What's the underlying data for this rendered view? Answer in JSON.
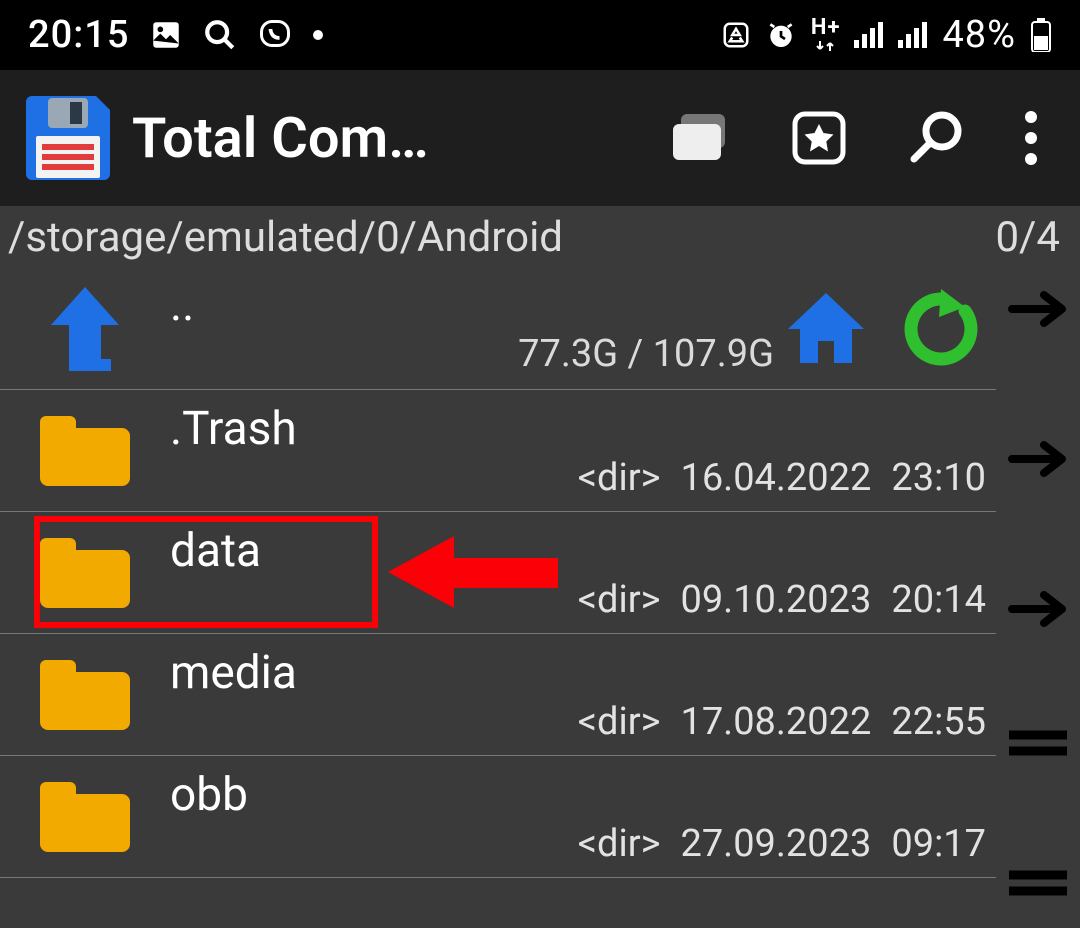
{
  "status": {
    "time": "20:15",
    "battery": "48%"
  },
  "appbar": {
    "title": "Total Com…"
  },
  "path": "/storage/emulated/0/Android",
  "selection_count": "0/4",
  "parent": {
    "name": "..",
    "storage": "77.3G / 107.9G"
  },
  "items": [
    {
      "name": ".Trash",
      "type": "<dir>",
      "date": "16.04.2022",
      "time": "23:10"
    },
    {
      "name": "data",
      "type": "<dir>",
      "date": "09.10.2023",
      "time": "20:14"
    },
    {
      "name": "media",
      "type": "<dir>",
      "date": "17.08.2022",
      "time": "22:55"
    },
    {
      "name": "obb",
      "type": "<dir>",
      "date": "27.09.2023",
      "time": "09:17"
    }
  ]
}
